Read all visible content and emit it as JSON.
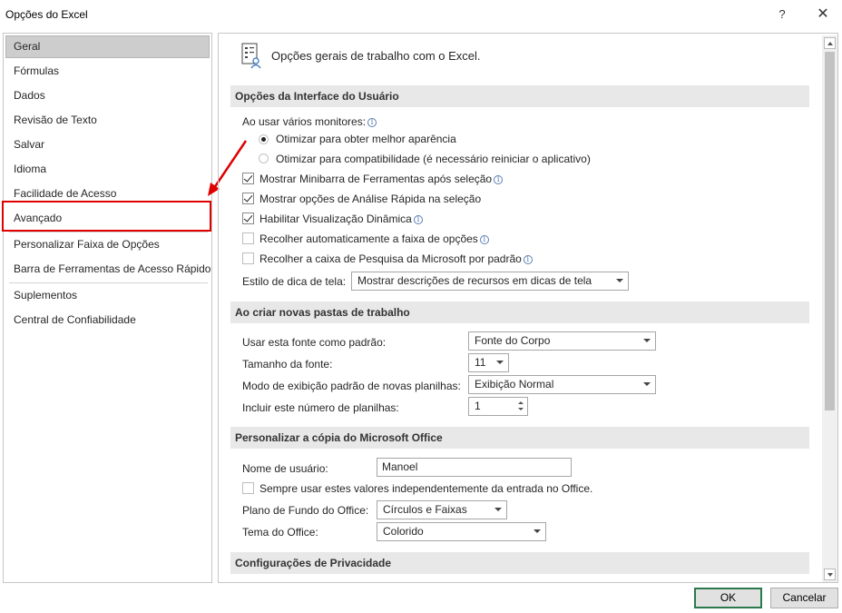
{
  "window": {
    "title": "Opções do Excel",
    "help": "?",
    "close": "✕"
  },
  "sidebar": {
    "items": [
      {
        "label": "Geral",
        "selected": true
      },
      {
        "label": "Fórmulas"
      },
      {
        "label": "Dados"
      },
      {
        "label": "Revisão de Texto"
      },
      {
        "label": "Salvar"
      },
      {
        "label": "Idioma"
      },
      {
        "label": "Facilidade de Acesso"
      },
      {
        "label": "Avançado",
        "highlighted": true
      },
      {
        "label": "Personalizar Faixa de Opções"
      },
      {
        "label": "Barra de Ferramentas de Acesso Rápido"
      },
      {
        "label": "Suplementos"
      },
      {
        "label": "Central de Confiabilidade"
      }
    ]
  },
  "annotation": {
    "color": "#e00000"
  },
  "main": {
    "header": "Opções gerais de trabalho com o Excel.",
    "ui_section": {
      "title": "Opções da Interface do Usuário",
      "multi_monitor_label": "Ao usar vários monitores:",
      "radio_optimize_appearance": "Otimizar para obter melhor aparência",
      "radio_optimize_compat": "Otimizar para compatibilidade (é necessário reiniciar o aplicativo)",
      "chk_minibar": "Mostrar Minibarra de Ferramentas após seleção",
      "chk_quick_analysis": "Mostrar opções de Análise Rápida na seleção",
      "chk_live_preview": "Habilitar Visualização Dinâmica",
      "chk_collapse_ribbon": "Recolher automaticamente a faixa de opções",
      "chk_collapse_search": "Recolher a caixa de Pesquisa da Microsoft por padrão",
      "tooltip_style_label": "Estilo de dica de tela:",
      "tooltip_style_value": "Mostrar descrições de recursos em dicas de tela"
    },
    "new_workbook_section": {
      "title": "Ao criar novas pastas de trabalho",
      "font_label": "Usar esta fonte como padrão:",
      "font_value": "Fonte do Corpo",
      "font_size_label": "Tamanho da fonte:",
      "font_size_value": "11",
      "view_label": "Modo de exibição padrão de novas planilhas:",
      "view_value": "Exibição Normal",
      "sheets_label": "Incluir este número de planilhas:",
      "sheets_value": "1"
    },
    "personalize_section": {
      "title": "Personalizar a cópia do Microsoft Office",
      "username_label": "Nome de usuário:",
      "username_value": "Manoel",
      "chk_always_use": "Sempre usar estes valores independentemente da entrada no Office.",
      "background_label": "Plano de Fundo do Office:",
      "background_value": "Círculos e Faixas",
      "theme_label": "Tema do Office:",
      "theme_value": "Colorido"
    },
    "privacy_section": {
      "title": "Configurações de Privacidade"
    }
  },
  "footer": {
    "ok": "OK",
    "cancel": "Cancelar"
  }
}
